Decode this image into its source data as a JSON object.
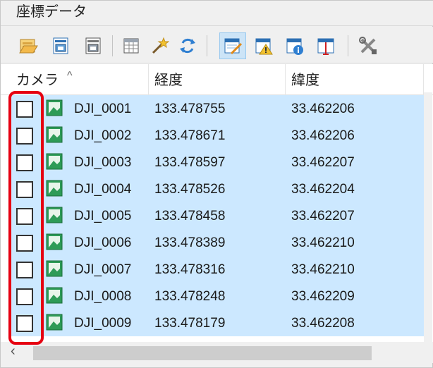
{
  "window": {
    "title": "座標データ"
  },
  "toolbar": {
    "buttons": [
      {
        "name": "open-folder-icon",
        "active": false
      },
      {
        "name": "save-icon",
        "active": false
      },
      {
        "name": "save-as-icon",
        "active": false
      },
      {
        "name": "table-icon",
        "active": false
      },
      {
        "name": "wand-icon",
        "active": false
      },
      {
        "name": "refresh-icon",
        "active": false
      },
      {
        "name": "edit-sheet-icon",
        "active": true
      },
      {
        "name": "warning-sheet-icon",
        "active": false
      },
      {
        "name": "info-sheet-icon",
        "active": false
      },
      {
        "name": "column-resize-icon",
        "active": false
      },
      {
        "name": "tools-icon",
        "active": false
      }
    ]
  },
  "columns": {
    "camera": "カメラ",
    "longitude": "経度",
    "latitude": "緯度"
  },
  "rows": [
    {
      "name": "DJI_0001",
      "lon": "133.478755",
      "lat": "33.462206",
      "checked": false
    },
    {
      "name": "DJI_0002",
      "lon": "133.478671",
      "lat": "33.462206",
      "checked": false
    },
    {
      "name": "DJI_0003",
      "lon": "133.478597",
      "lat": "33.462207",
      "checked": false
    },
    {
      "name": "DJI_0004",
      "lon": "133.478526",
      "lat": "33.462204",
      "checked": false
    },
    {
      "name": "DJI_0005",
      "lon": "133.478458",
      "lat": "33.462207",
      "checked": false
    },
    {
      "name": "DJI_0006",
      "lon": "133.478389",
      "lat": "33.462210",
      "checked": false
    },
    {
      "name": "DJI_0007",
      "lon": "133.478316",
      "lat": "33.462210",
      "checked": false
    },
    {
      "name": "DJI_0008",
      "lon": "133.478248",
      "lat": "33.462209",
      "checked": false
    },
    {
      "name": "DJI_0009",
      "lon": "133.478179",
      "lat": "33.462208",
      "checked": false
    }
  ],
  "colors": {
    "selection": "#cce8ff",
    "highlight": "#e60012",
    "active_button": "#cce4f7"
  }
}
